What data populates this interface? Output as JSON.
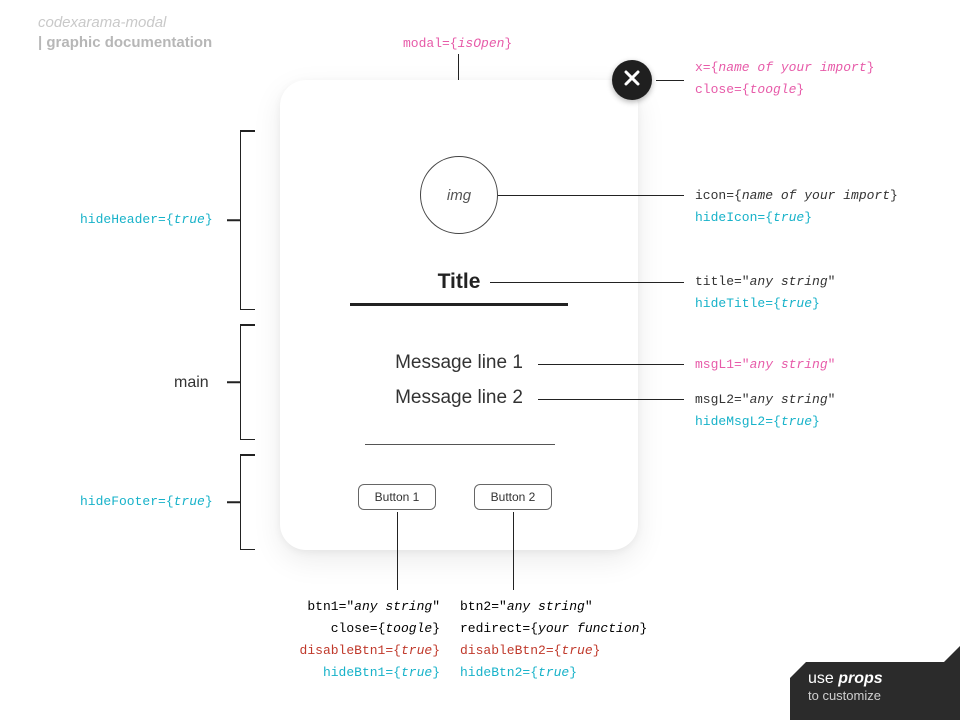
{
  "header": {
    "name": "codexarama-modal",
    "subtitle": "| graphic documentation"
  },
  "top_ann": {
    "modal": "modal={",
    "modal_v": "isOpen",
    "modal_end": "}"
  },
  "close": {
    "x_label": "x={",
    "x_val": "name of your import",
    "x_end": "}",
    "close_label": "close={",
    "close_val": "toogle",
    "close_end": "}"
  },
  "icon": {
    "placeholder": "img",
    "icon_label": "icon={",
    "icon_val": "name of your import",
    "icon_end": "}",
    "hide_label": "hideIcon={",
    "hide_val": "true",
    "hide_end": "}"
  },
  "title": {
    "text": "Title",
    "label": "title=\"",
    "val": "any string",
    "end": "\"",
    "hide_label": "hideTitle={",
    "hide_val": "true",
    "hide_end": "}"
  },
  "msg": {
    "l1": "Message line 1",
    "l2": "Message line 2",
    "l1_label": "msgL1=\"",
    "l1_val": "any string",
    "l1_end": "\"",
    "l2_label": "msgL2=\"",
    "l2_val": "any string",
    "l2_end": "\"",
    "hide2_label": "hideMsgL2={",
    "hide2_val": "true",
    "hide2_end": "}"
  },
  "left": {
    "hideHeader_label": "hideHeader={",
    "hideHeader_val": "true",
    "hideHeader_end": "}",
    "main": "main",
    "hideFooter_label": "hideFooter={",
    "hideFooter_val": "true",
    "hideFooter_end": "}"
  },
  "btn1": {
    "text": "Button 1",
    "label": "btn1=\"",
    "val": "any string",
    "end": "\"",
    "close_label": "close={",
    "close_val": "toogle",
    "close_end": "}",
    "disable_label": "disableBtn1={",
    "disable_val": "true",
    "disable_end": "}",
    "hide_label": "hideBtn1={",
    "hide_val": "true",
    "hide_end": "}"
  },
  "btn2": {
    "text": "Button 2",
    "label": "btn2=\"",
    "val": "any string",
    "end": "\"",
    "redirect_label": "redirect={",
    "redirect_val": "your function",
    "redirect_end": "}",
    "disable_label": "disableBtn2={",
    "disable_val": "true",
    "disable_end": "}",
    "hide_label": "hideBtn2={",
    "hide_val": "true",
    "hide_end": "}"
  },
  "badge": {
    "pre": "use ",
    "word": "props",
    "line2": "to customize"
  }
}
